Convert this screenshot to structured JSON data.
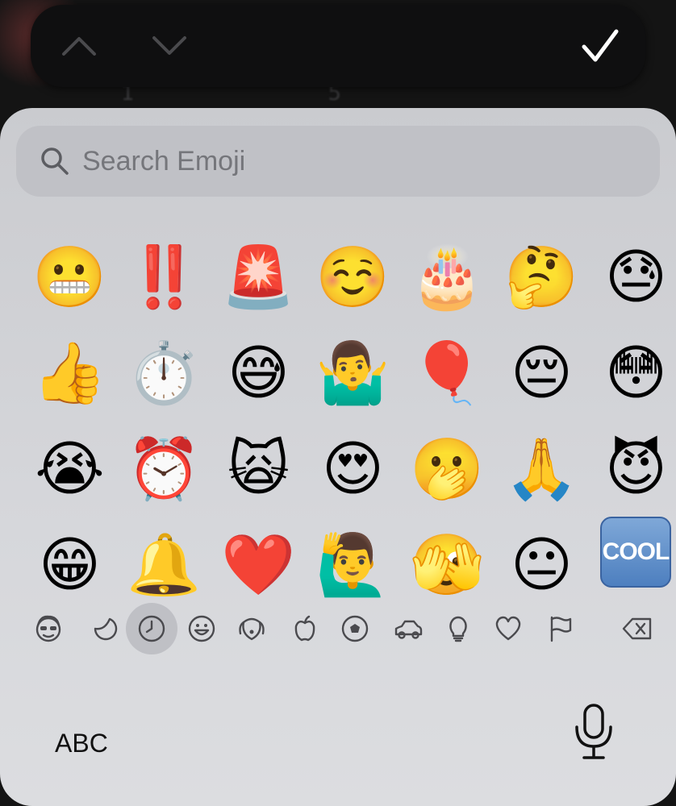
{
  "background": {
    "reply_count": "1",
    "like_count": "5"
  },
  "toolbar": {
    "up_icon": "chevron-up-icon",
    "down_icon": "chevron-down-icon",
    "done_icon": "checkmark-icon"
  },
  "search": {
    "placeholder": "Search Emoji",
    "icon": "magnifier-icon"
  },
  "emojis": [
    [
      "😬",
      "‼️",
      "🚨",
      "☺️",
      "🎂",
      "🤔",
      "😓"
    ],
    [
      "👍",
      "⏱️",
      "😅",
      "🤷‍♂️",
      "🎈",
      "😔",
      "😳"
    ],
    [
      "😭",
      "⏰",
      "🙀",
      "😍",
      "🫢",
      "🙏",
      "😈"
    ],
    [
      "😁",
      "🔔",
      "❤️",
      "🙋‍♂️",
      "🫣",
      "😐",
      "COOL"
    ]
  ],
  "categories": [
    {
      "name": "memoji-icon"
    },
    {
      "name": "sticker-icon"
    },
    {
      "name": "recent-clock-icon",
      "active": true
    },
    {
      "name": "smiley-icon"
    },
    {
      "name": "animal-icon"
    },
    {
      "name": "food-apple-icon"
    },
    {
      "name": "activity-ball-icon"
    },
    {
      "name": "travel-car-icon"
    },
    {
      "name": "objects-bulb-icon"
    },
    {
      "name": "symbols-heart-icon"
    },
    {
      "name": "flags-icon"
    },
    {
      "name": "delete-icon"
    }
  ],
  "bottom": {
    "abc_label": "ABC",
    "mic_icon": "microphone-icon"
  },
  "colors": {
    "keyboard_bg": "#d3d4d8",
    "search_bg": "#c0c1c6",
    "toolbar_bg": "#0f0f10"
  }
}
